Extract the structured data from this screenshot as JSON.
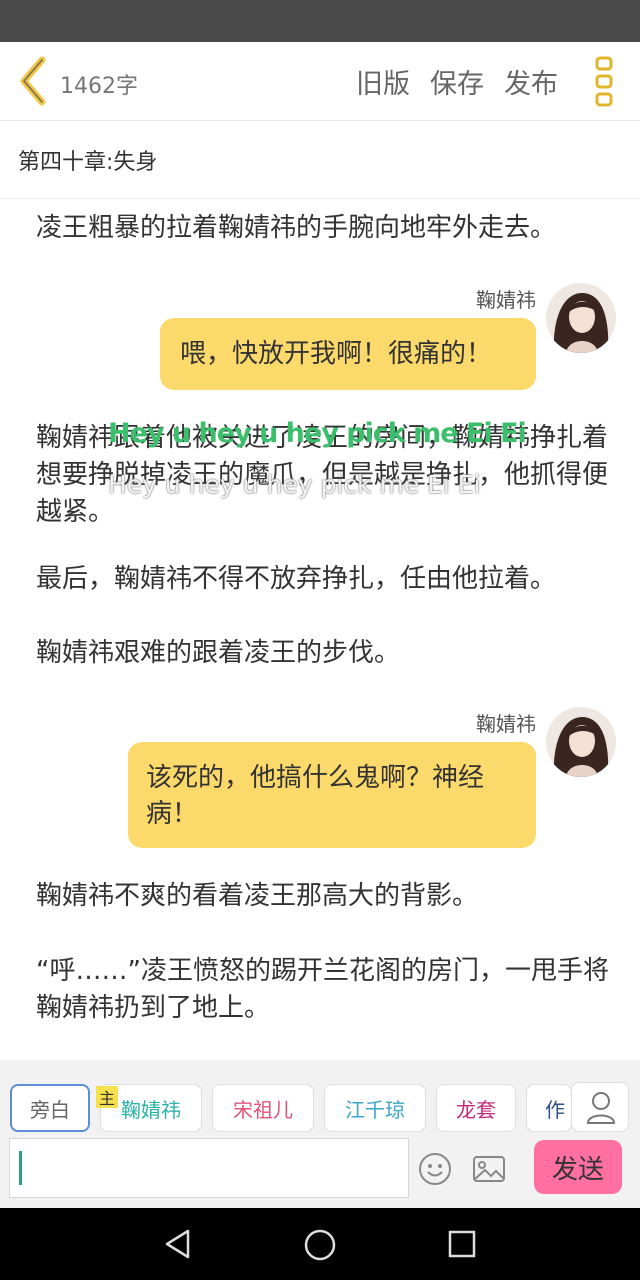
{
  "header": {
    "word_count": "1462字",
    "actions": [
      "旧版",
      "保存",
      "发布"
    ],
    "accent_color": "#f2c94c"
  },
  "chapter": {
    "title": "第四十章:失身"
  },
  "content": {
    "p1": "凌王粗暴的拉着鞠婧祎的手腕向地牢外走去。",
    "dialog1": {
      "speaker": "鞠婧祎",
      "text": "喂，快放开我啊！很痛的！"
    },
    "p2": "鞠婧祎跟着他被关进了凌王的房间，鞠婧祎挣扎着想要挣脱掉凌王的魔爪，但是越是挣扎，他抓得便越紧。",
    "p3": "最后，鞠婧祎不得不放弃挣扎，任由他拉着。",
    "p4": "鞠婧祎艰难的跟着凌王的步伐。",
    "dialog2": {
      "speaker": "鞠婧祎",
      "text": "该死的，他搞什么鬼啊？神经病！"
    },
    "p5": "鞠婧祎不爽的看着凌王那高大的背影。",
    "p6": "“呼……”凌王愤怒的踢开兰花阁的房门，一甩手将鞠婧祎扔到了地上。"
  },
  "overlays": {
    "line1": "Hey u hey u hey pick me Ei Ei",
    "line2": "Hey u hey u hey pick me Ei Ei"
  },
  "roles": {
    "narrator": "旁白",
    "main_tag": "主",
    "items": [
      {
        "label": "鞠婧祎",
        "color": "#2bb3a8"
      },
      {
        "label": "宋祖儿",
        "color": "#e0557a"
      },
      {
        "label": "江千琼",
        "color": "#3aa6c9"
      },
      {
        "label": "龙套",
        "color": "#c02a7a"
      },
      {
        "label": "作",
        "color": "#334f8a"
      }
    ]
  },
  "input": {
    "value": ""
  },
  "send_button": {
    "label": "发送",
    "color": "#ff6f9f"
  }
}
